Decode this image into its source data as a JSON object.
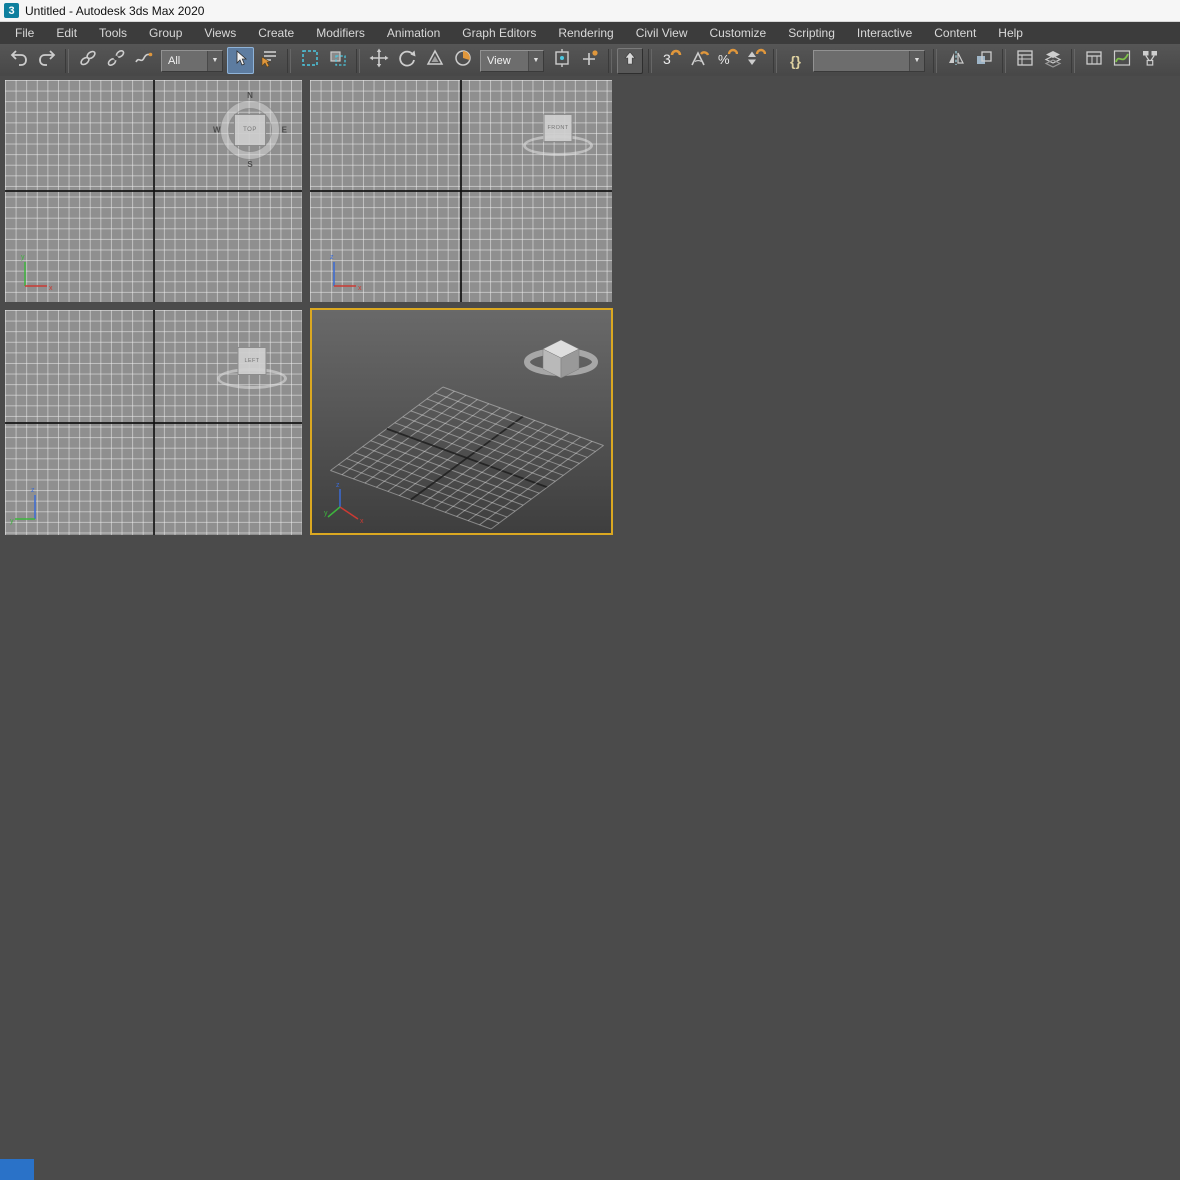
{
  "window": {
    "logo": "3",
    "title": "Untitled - Autodesk 3ds Max 2020"
  },
  "menu": {
    "items": [
      "File",
      "Edit",
      "Tools",
      "Group",
      "Views",
      "Create",
      "Modifiers",
      "Animation",
      "Graph Editors",
      "Rendering",
      "Civil View",
      "Customize",
      "Scripting",
      "Interactive",
      "Content",
      "Help"
    ]
  },
  "toolbar": {
    "selection_filter_value": "All",
    "coordinate_system_value": "View",
    "named_sets_value": "",
    "snap_3d_label": "3",
    "percent_label": "%",
    "braces_label": "{}",
    "combo_arrow": "▼"
  },
  "viewports": {
    "top": {
      "cube_label": "TOP",
      "compass": {
        "n": "N",
        "e": "E",
        "s": "S",
        "w": "W"
      },
      "axes": {
        "h": "x",
        "v": "y"
      }
    },
    "front": {
      "cube_label": "FRONT",
      "axes": {
        "h": "x",
        "v": "z"
      }
    },
    "left": {
      "cube_label": "LEFT",
      "axes": {
        "h": "y",
        "v": "z"
      }
    },
    "perspective": {
      "axes": {
        "x": "x",
        "y": "y",
        "z": "z"
      }
    }
  },
  "colors": {
    "active_viewport_border": "#dba821",
    "accent_cyan": "#4cc8e0",
    "accent_orange": "#e0973c",
    "toolbar_bg": "#4d4d4d"
  }
}
